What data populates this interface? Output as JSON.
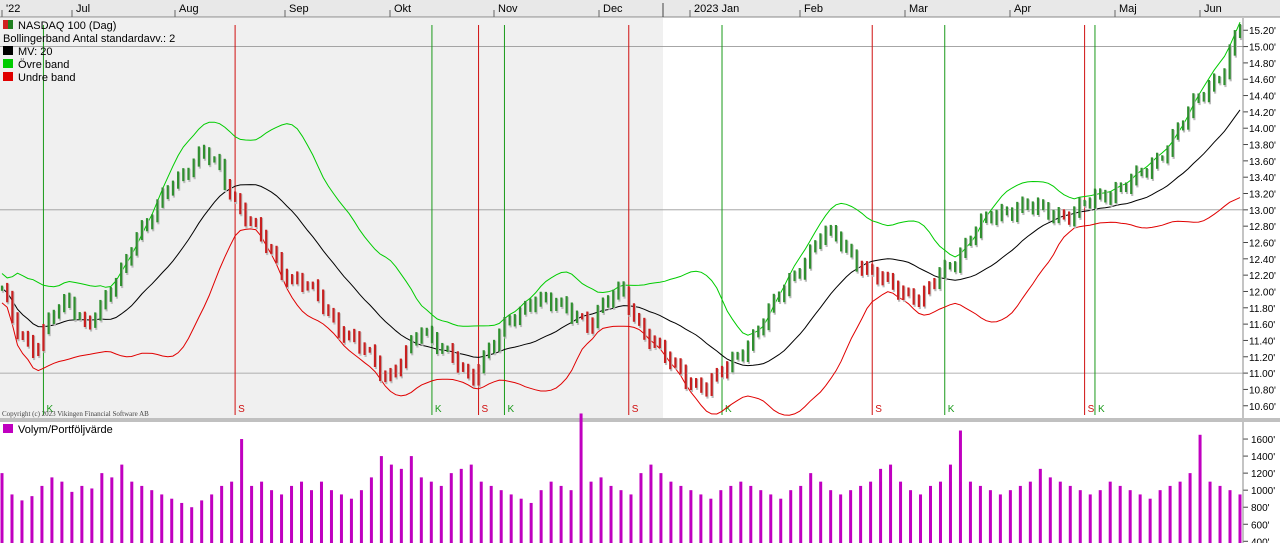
{
  "chart_data": [
    {
      "type": "ohlc",
      "title": "NASDAQ 100 (Dag)",
      "indicator_label": "Bollingerband  Antal standardavv.: 2",
      "legend": [
        {
          "label": "NASDAQ 100 (Dag)",
          "color": "#d02020",
          "color2": "#208020"
        },
        {
          "label": "Bollingerband  Antal standardavv.: 2",
          "color": null
        },
        {
          "label": "MV: 20",
          "color": "#000000"
        },
        {
          "label": "Övre band",
          "color": "#00cc00"
        },
        {
          "label": "Undre band",
          "color": "#e00000"
        }
      ],
      "x_tick_labels": [
        "'22",
        "Jul",
        "Aug",
        "Sep",
        "Okt",
        "Nov",
        "Dec",
        "2023 Jan",
        "Feb",
        "Mar",
        "Apr",
        "Maj",
        "Jun"
      ],
      "y_tick_labels": [
        "15.20'",
        "15.00'",
        "14.80'",
        "14.60'",
        "14.40'",
        "14.20'",
        "14.00'",
        "13.80'",
        "13.60'",
        "13.40'",
        "13.20'",
        "13.00'",
        "12.80'",
        "12.60'",
        "12.40'",
        "12.20'",
        "12.00'",
        "11.80'",
        "11.60'",
        "11.40'",
        "11.20'",
        "11.00'",
        "10.80'",
        "10.60'"
      ],
      "y_ticks": [
        15200,
        15000,
        14800,
        14600,
        14400,
        14200,
        14000,
        13800,
        13600,
        13400,
        13200,
        13000,
        12800,
        12600,
        12400,
        12200,
        12000,
        11800,
        11600,
        11400,
        11200,
        11000,
        10800,
        10600
      ],
      "ylim": [
        10450,
        15350
      ],
      "gridlines": [
        15000,
        13000,
        11000
      ],
      "close_series": [
        12000,
        11500,
        11300,
        11700,
        11900,
        11600,
        11800,
        12200,
        12700,
        12900,
        13300,
        13500,
        13700,
        13500,
        13100,
        12800,
        12500,
        12200,
        12100,
        11900,
        11600,
        11400,
        11200,
        10950,
        11200,
        11500,
        11400,
        11200,
        10850,
        11300,
        11600,
        11700,
        11950,
        11900,
        11700,
        11600,
        11900,
        12000,
        11600,
        11400,
        11100,
        10900,
        10850,
        11000,
        11200,
        11500,
        11800,
        12100,
        12400,
        12700,
        12650,
        12400,
        12200,
        12100,
        12000,
        11900,
        12200,
        12400,
        12700,
        12900,
        13000,
        13050,
        13000,
        12950,
        12950,
        13100,
        13200,
        13300,
        13400,
        13600,
        13900,
        14200,
        14500,
        14700,
        15250
      ],
      "signals": [
        {
          "label": "K",
          "type": "buy",
          "date_index": 8
        },
        {
          "label": "S",
          "type": "sell",
          "date_index": 45
        },
        {
          "label": "K",
          "type": "buy",
          "date_index": 83
        },
        {
          "label": "S",
          "type": "sell",
          "date_index": 92
        },
        {
          "label": "K",
          "type": "buy",
          "date_index": 97
        },
        {
          "label": "S",
          "type": "sell",
          "date_index": 121
        },
        {
          "label": "K",
          "type": "buy",
          "date_index": 139
        },
        {
          "label": "S",
          "type": "sell",
          "date_index": 168
        },
        {
          "label": "K",
          "type": "buy",
          "date_index": 182
        },
        {
          "label": "S",
          "type": "sell",
          "date_index": 209
        },
        {
          "label": "K",
          "type": "buy",
          "date_index": 211
        }
      ],
      "copyright": "Copyright (c) 2023 Vikingen Financial Software AB"
    },
    {
      "type": "bar",
      "title": "Volym/Portföljvärde",
      "legend": [
        {
          "label": "Volym/Portföljvärde",
          "color": "#c000c0"
        }
      ],
      "y_tick_labels": [
        "1600'",
        "1400'",
        "1200'",
        "1000'",
        "800'",
        "600'",
        "400'"
      ],
      "y_ticks": [
        1600,
        1400,
        1200,
        1000,
        800,
        600,
        400
      ],
      "ylim": [
        380,
        1800
      ],
      "volume_series": [
        1200,
        950,
        880,
        930,
        1050,
        1150,
        1100,
        980,
        1050,
        1020,
        1200,
        1150,
        1300,
        1100,
        1050,
        1000,
        950,
        900,
        850,
        800,
        880,
        950,
        1050,
        1100,
        1600,
        1050,
        1100,
        1000,
        950,
        1050,
        1100,
        1000,
        1100,
        1000,
        950,
        900,
        1000,
        1150,
        1400,
        1300,
        1250,
        1400,
        1150,
        1100,
        1050,
        1200,
        1250,
        1300,
        1100,
        1050,
        1000,
        950,
        900,
        850,
        1000,
        1100,
        1050,
        1000,
        1900,
        1100,
        1150,
        1050,
        1000,
        950,
        1200,
        1300,
        1200,
        1100,
        1050,
        1000,
        950,
        900,
        1000,
        1050,
        1100,
        1050,
        1000,
        950,
        900,
        1000,
        1050,
        1200,
        1100,
        1000,
        950,
        1000,
        1050,
        1100,
        1250,
        1300,
        1100,
        1000,
        950,
        1050,
        1100,
        1300,
        1700,
        1100,
        1050,
        1000,
        950,
        1000,
        1050,
        1100,
        1250,
        1150,
        1100,
        1050,
        1000,
        950,
        1000,
        1100,
        1050,
        1000,
        950,
        900,
        1000,
        1050,
        1100,
        1200,
        1650,
        1100,
        1050,
        1000,
        950
      ],
      "annotations": []
    }
  ]
}
